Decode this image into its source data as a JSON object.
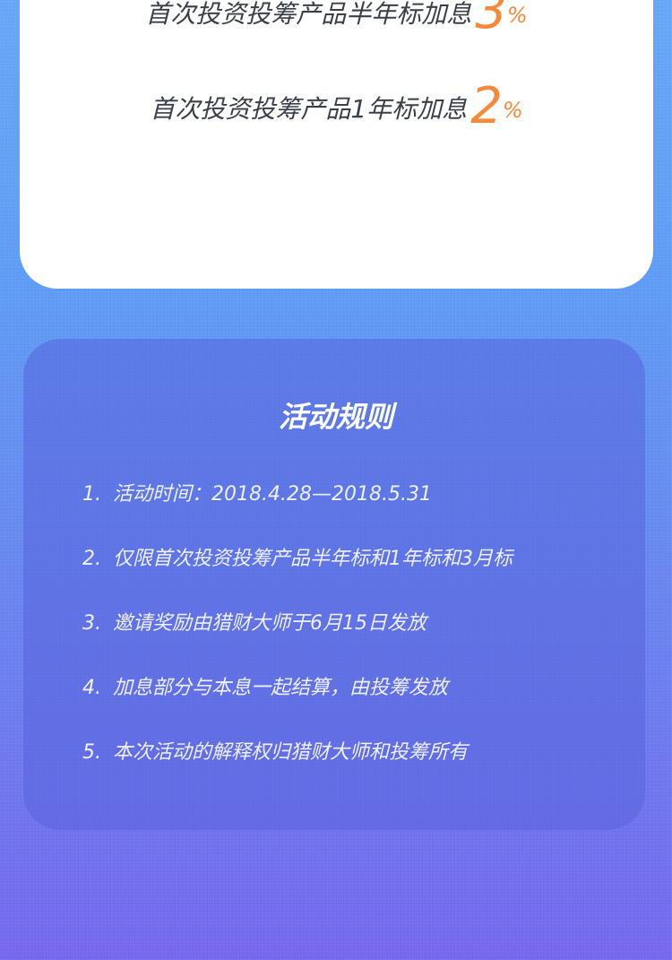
{
  "bonus_card": {
    "lines": [
      {
        "text": "首次投资投筹产品半年标加息",
        "rate": "3",
        "unit": "%"
      },
      {
        "text": "首次投资投筹产品1年标加息",
        "rate": "2",
        "unit": "%"
      }
    ]
  },
  "rules": {
    "title": "活动规则",
    "items": [
      {
        "num": "1.",
        "text": "活动时间：2018.4.28—2018.5.31"
      },
      {
        "num": "2.",
        "text": "仅限首次投资投筹产品半年标和1年标和3月标"
      },
      {
        "num": "3.",
        "text": "邀请奖励由猎财大师于6月15日发放"
      },
      {
        "num": "4.",
        "text": "加息部分与本息一起结算，由投筹发放"
      },
      {
        "num": "5.",
        "text": "本次活动的解释权归猎财大师和投筹所有"
      }
    ]
  },
  "colors": {
    "accent": "#f7893b",
    "card_bg": "#ffffff",
    "rules_card_bg": "#5864dc"
  }
}
